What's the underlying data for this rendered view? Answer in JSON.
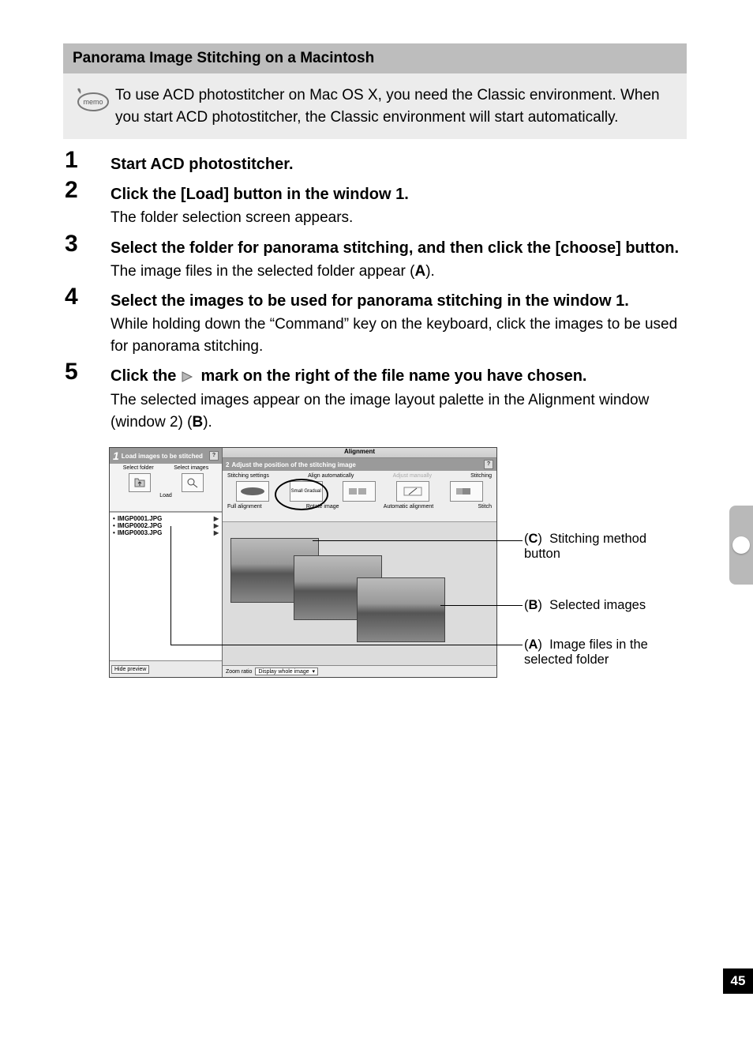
{
  "section_header": "Panorama Image Stitching on a Macintosh",
  "memo": {
    "icon_label": "memo",
    "text": "To use ACD photostitcher on Mac OS X, you need the Classic environment. When you start ACD photostitcher, the Classic environment will start automatically."
  },
  "steps": [
    {
      "num": "1",
      "title": "Start ACD photostitcher.",
      "desc": ""
    },
    {
      "num": "2",
      "title": "Click the [Load] button in the window 1.",
      "desc": "The folder selection screen appears."
    },
    {
      "num": "3",
      "title": "Select the folder for panorama stitching, and then click the [choose] button.",
      "desc_html": "The image files in the selected folder appear (<b>A</b>)."
    },
    {
      "num": "4",
      "title": "Select the images to be used for panorama stitching in the window 1.",
      "desc": "While holding down the “Command” key on the keyboard, click the images to be used for panorama stitching."
    },
    {
      "num": "5",
      "title_pre": "Click the ",
      "title_post": " mark on the right of the file name you have chosen.",
      "desc_html": "The selected images appear on the image layout palette in the Alignment window (window 2) (<b>B</b>)."
    }
  ],
  "figure": {
    "window_title": "Alignment",
    "left_pane": {
      "header_num": "1",
      "header_text": "Load images to be stitched",
      "select_folder": "Select folder",
      "select_images": "Select images",
      "load_label": "Load",
      "files": [
        "IMGP0001.JPG",
        "IMGP0002.JPG",
        "IMGP0003.JPG"
      ],
      "hide_preview": "Hide preview"
    },
    "right_pane": {
      "header_num": "2",
      "header_text": "Adjust the position of the stitching image",
      "tb_labels": [
        "Stitching settings",
        "Align automatically",
        "Adjust manually",
        "Stitching"
      ],
      "small_gradual": "Small Gradual",
      "auto_align": "Automatic alignment",
      "stitch": "Stitch",
      "full_alignment": "Full alignment",
      "rotate_image": "Rotate image",
      "zoom_ratio": "Zoom ratio",
      "zoom_select": "Display whole image"
    },
    "callouts": {
      "C": {
        "letter": "C",
        "text": "Stitching method button"
      },
      "B": {
        "letter": "B",
        "text": "Selected images"
      },
      "A": {
        "letter": "A",
        "text": "Image files in the selected folder"
      }
    }
  },
  "page_number": "45"
}
